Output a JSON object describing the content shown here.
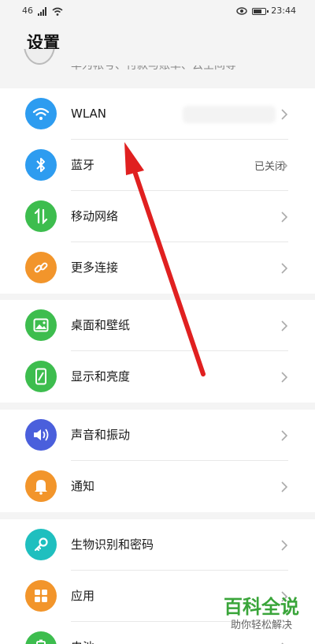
{
  "status_bar": {
    "left_text": "46",
    "time": "23:44"
  },
  "header": {
    "title": "设置"
  },
  "account": {
    "text": "华为帐号、付款与账单、云空间等"
  },
  "groups": [
    {
      "items": [
        {
          "label": "WLAN",
          "value": "",
          "icon": "wifi-icon",
          "color": "#2d9cf0"
        },
        {
          "label": "蓝牙",
          "value": "已关闭",
          "icon": "bluetooth-icon",
          "color": "#2d9cf0"
        },
        {
          "label": "移动网络",
          "value": "",
          "icon": "mobile-data-icon",
          "color": "#3dbd4e"
        },
        {
          "label": "更多连接",
          "value": "",
          "icon": "link-icon",
          "color": "#f2952b"
        }
      ]
    },
    {
      "items": [
        {
          "label": "桌面和壁纸",
          "value": "",
          "icon": "image-icon",
          "color": "#3dbd4e"
        },
        {
          "label": "显示和亮度",
          "value": "",
          "icon": "display-icon",
          "color": "#3dbd4e"
        }
      ]
    },
    {
      "items": [
        {
          "label": "声音和振动",
          "value": "",
          "icon": "speaker-icon",
          "color": "#4a5fdc"
        },
        {
          "label": "通知",
          "value": "",
          "icon": "bell-icon",
          "color": "#f2952b"
        }
      ]
    },
    {
      "items": [
        {
          "label": "生物识别和密码",
          "value": "",
          "icon": "key-icon",
          "color": "#1fbfbf"
        },
        {
          "label": "应用",
          "value": "",
          "icon": "apps-grid-icon",
          "color": "#f2952b"
        },
        {
          "label": "电池",
          "value": "",
          "icon": "battery-icon",
          "color": "#3dbd4e"
        }
      ]
    }
  ],
  "watermark": {
    "main": "百科全说",
    "sub": "助你轻松解决"
  },
  "colors": {
    "annotation_arrow": "#e02020",
    "watermark_green": "#3aa53a"
  }
}
